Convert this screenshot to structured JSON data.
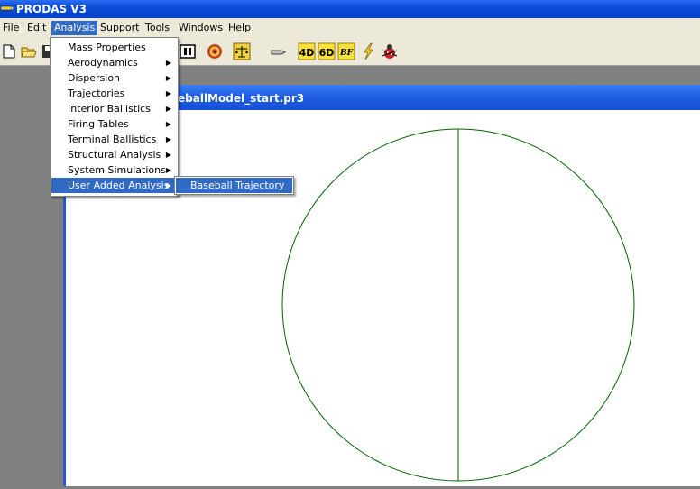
{
  "app": {
    "title": "PRODAS V3"
  },
  "menubar": {
    "file": "File",
    "edit": "Edit",
    "analysis": "Analysis",
    "support": "Support",
    "tools": "Tools",
    "windows": "Windows",
    "help": "Help"
  },
  "toolbar": {
    "icons": [
      "new-file-icon",
      "open-folder-icon",
      "save-icon",
      "library-icon",
      "target-icon",
      "balance-scale-icon",
      "projectile-icon",
      "4d-icon",
      "6d-icon",
      "bf-icon",
      "lightning-icon",
      "bug-icon"
    ],
    "labels": {
      "four_d": "4D",
      "six_d": "6D",
      "bf": "BF"
    }
  },
  "child_window": {
    "title_visible": "eballModel_start.pr3"
  },
  "analysis_menu": {
    "items": [
      {
        "label": "Mass Properties",
        "submenu": false
      },
      {
        "label": "Aerodynamics",
        "submenu": true
      },
      {
        "label": "Dispersion",
        "submenu": true
      },
      {
        "label": "Trajectories",
        "submenu": true
      },
      {
        "label": "Interior Ballistics",
        "submenu": true
      },
      {
        "label": "Firing Tables",
        "submenu": true
      },
      {
        "label": "Terminal Ballistics",
        "submenu": true
      },
      {
        "label": "Structural Analysis",
        "submenu": true
      },
      {
        "label": "System Simulations",
        "submenu": true
      },
      {
        "label": "User Added Analysis",
        "submenu": true,
        "highlighted": true
      }
    ],
    "arrow_glyph": "▶"
  },
  "user_added_submenu": {
    "items": [
      "Baseball Trajectory"
    ]
  },
  "colors": {
    "highlight": "#316ac5",
    "title_blue": "#0a4ad8",
    "canvas_line": "#006400",
    "menu_bg": "#ece9d8"
  }
}
